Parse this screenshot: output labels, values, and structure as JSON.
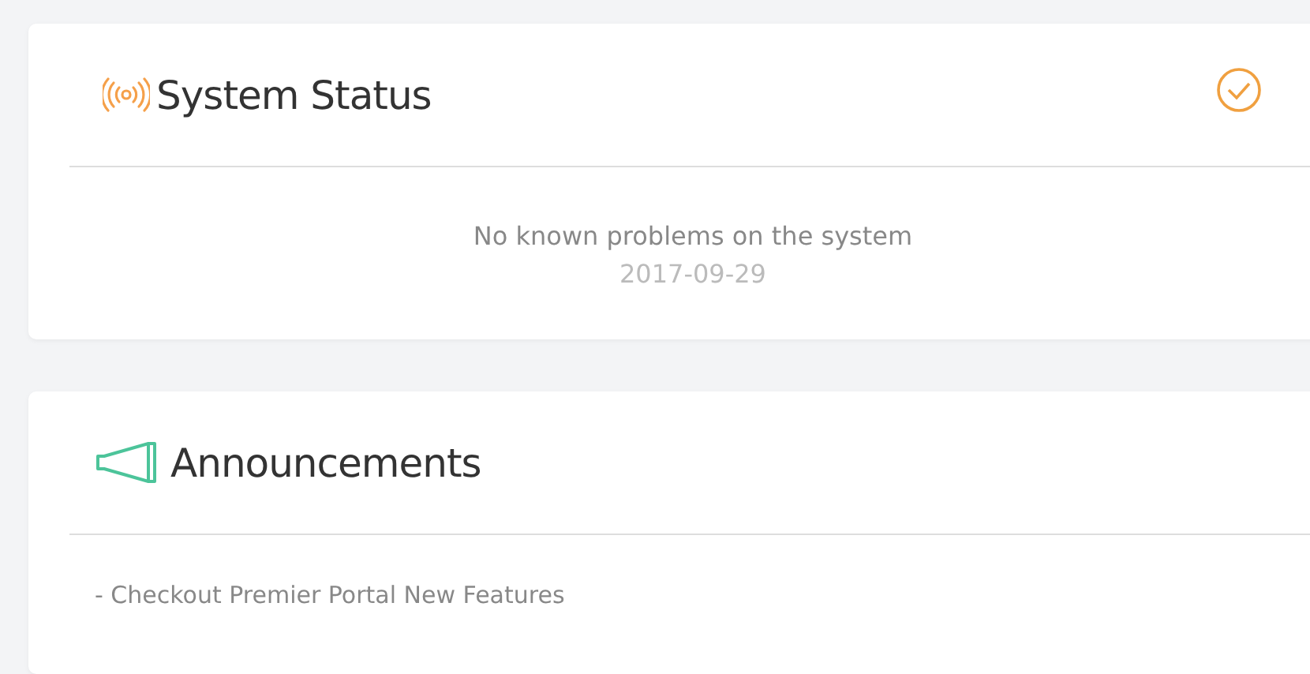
{
  "system_status": {
    "title": "System Status",
    "message": "No known problems on the system",
    "date": "2017-09-29"
  },
  "announcements": {
    "title": "Announcements",
    "items": [
      "- Checkout Premier Portal New Features"
    ]
  }
}
